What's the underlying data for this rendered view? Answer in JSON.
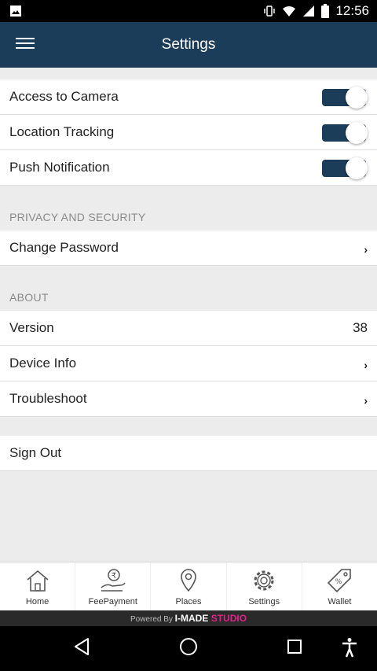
{
  "status_bar": {
    "time": "12:56"
  },
  "header": {
    "title": "Settings",
    "menu_icon": "hamburger-menu-icon"
  },
  "toggles": [
    {
      "label": "Access to Camera",
      "state": "on"
    },
    {
      "label": "Location Tracking",
      "state": "on"
    },
    {
      "label": "Push Notification",
      "state": "on"
    }
  ],
  "privacy": {
    "header": "PRIVACY AND SECURITY",
    "change_password": "Change Password",
    "chevron": "›"
  },
  "about": {
    "header": "ABOUT",
    "version_label": "Version",
    "version_value": "38",
    "device_info": "Device Info",
    "troubleshoot": "Troubleshoot",
    "chevron": "›"
  },
  "sign_out": "Sign Out",
  "tabs": [
    {
      "label": "Home",
      "icon": "home-icon"
    },
    {
      "label": "FeePayment",
      "icon": "fee-payment-icon"
    },
    {
      "label": "Places",
      "icon": "location-pin-icon"
    },
    {
      "label": "Settings",
      "icon": "gear-icon"
    },
    {
      "label": "Wallet",
      "icon": "tag-icon"
    }
  ],
  "footer": {
    "powered_by": "Powered By",
    "brand_main": "I-MADE",
    "brand_sub": "STUDIO"
  },
  "colors": {
    "primary": "#1c3d5a",
    "background": "#ececec",
    "brand_accent": "#e0218a"
  }
}
